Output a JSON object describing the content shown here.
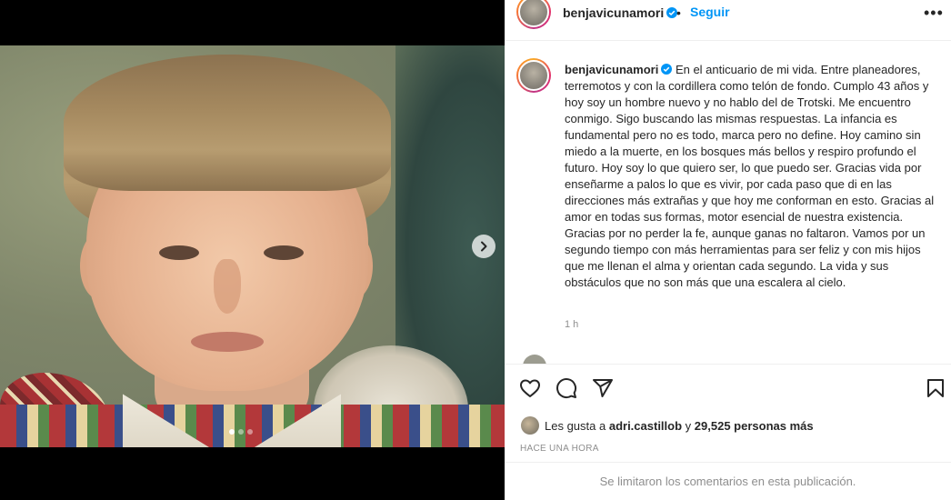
{
  "post": {
    "username": "benjavicunamori",
    "follow_label": "Seguir",
    "more_label": "•••",
    "separator": "•",
    "caption": "En el anticuario de mi vida. Entre planeadores, terremotos y con la cordillera como telón de fondo. Cumplo 43 años y hoy soy un hombre nuevo y no hablo del de Trotski. Me encuentro conmigo. Sigo buscando las mismas respuestas. La infancia es fundamental pero no es todo, marca pero no define. Hoy camino sin miedo a la muerte, en los bosques más bellos y respiro profundo el futuro. Hoy soy lo que quiero ser, lo que puedo ser. Gracias vida por enseñarme a palos lo que es vivir, por cada paso que di en las direcciones más extrañas y que hoy me conforman en esto. Gracias al amor en todas sus formas, motor esencial de nuestra existencia. Gracias por no perder la fe, aunque ganas no faltaron. Vamos por un segundo tiempo con más herramientas para ser feliz y con mis hijos que me llenan el alma y orientan cada segundo. La vida y sus obstáculos que no son más que una escalera al cielo.",
    "caption_time": "1 h",
    "comment_peek": "",
    "likes_prefix": "Les gusta a",
    "likes_user": "adri.castillob",
    "likes_connector": "y",
    "likes_count": "29,525 personas más",
    "posted_label": "HACE UNA HORA",
    "comments_limited": "Se limitaron los comentarios en esta publicación."
  },
  "carousel": {
    "total": 3,
    "current": 1
  },
  "colors": {
    "link": "#0095f6",
    "verified": "#0095f6",
    "muted": "#8e8e8e"
  },
  "icons": [
    "verified-badge-icon",
    "more-options-icon",
    "chevron-right-icon",
    "heart-icon",
    "comment-icon",
    "share-icon",
    "bookmark-icon"
  ]
}
